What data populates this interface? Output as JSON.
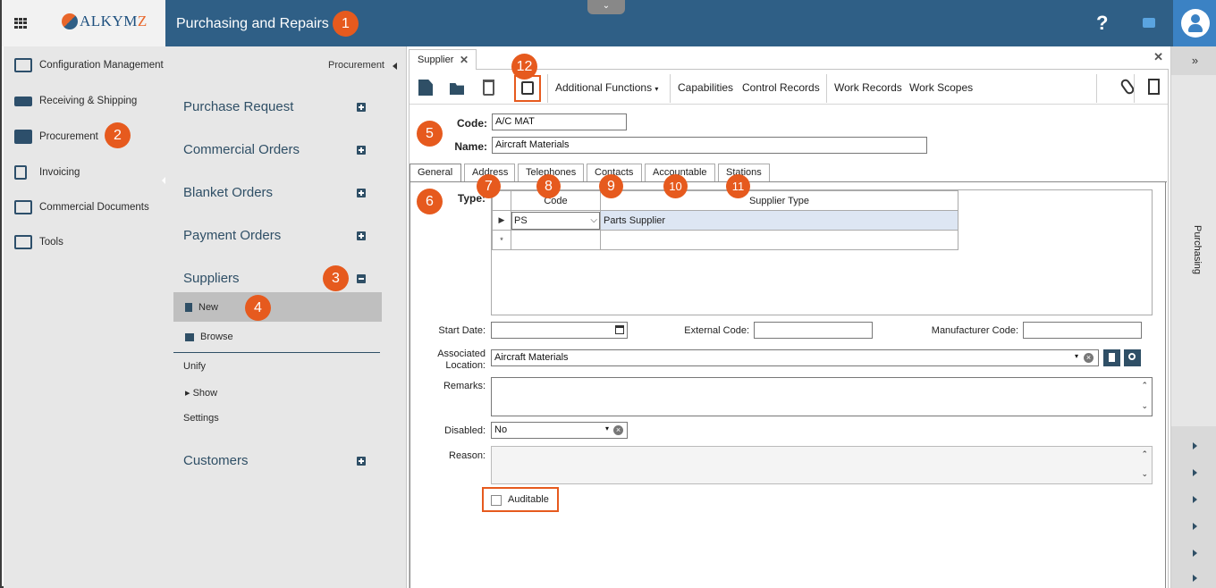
{
  "header": {
    "brand": "ALKYMZ",
    "brand_prefix": "ALKYM",
    "brand_suffix": "Z",
    "title": "Purchasing and Repairs",
    "help_glyph": "?"
  },
  "sidebar": {
    "items": [
      {
        "label": "Configuration Management",
        "icon": "edit-icon"
      },
      {
        "label": "Receiving & Shipping",
        "icon": "truck-icon"
      },
      {
        "label": "Procurement",
        "icon": "briefcase-icon"
      },
      {
        "label": "Invoicing",
        "icon": "invoice-icon"
      },
      {
        "label": "Commercial Documents",
        "icon": "documents-icon"
      },
      {
        "label": "Tools",
        "icon": "tools-icon"
      }
    ]
  },
  "nav": {
    "crumb": "Procurement",
    "groups": [
      "Purchase Request",
      "Commercial Orders",
      "Blanket Orders",
      "Payment Orders",
      "Suppliers",
      "Customers"
    ],
    "supplier_sub": {
      "new": "New",
      "browse": "Browse",
      "unify": "Unify",
      "show": "Show",
      "settings": "Settings"
    }
  },
  "document": {
    "tab_label": "Supplier",
    "close_glyph": "✕"
  },
  "toolbar": {
    "additional_functions": "Additional Functions",
    "capabilities": "Capabilities",
    "control_records": "Control Records",
    "work_records": "Work Records",
    "work_scopes": "Work Scopes"
  },
  "form": {
    "code_label": "Code:",
    "code_value": "A/C MAT",
    "name_label": "Name:",
    "name_value": "Aircraft Materials",
    "tabs": [
      "General",
      "Address",
      "Telephones",
      "Contacts",
      "Accountable",
      "Stations"
    ],
    "type_label": "Type:",
    "grid": {
      "col_code": "Code",
      "col_supplier_type": "Supplier Type",
      "rows": [
        {
          "code": "PS",
          "supplier_type": "Parts Supplier"
        }
      ],
      "new_row_marker": "*"
    },
    "start_date_label": "Start Date:",
    "external_code_label": "External Code:",
    "manufacturer_code_label": "Manufacturer Code:",
    "associated_location_label_1": "Associated",
    "associated_location_label_2": "Location:",
    "associated_location_value": "Aircraft Materials",
    "remarks_label": "Remarks:",
    "disabled_label": "Disabled:",
    "disabled_value": "No",
    "reason_label": "Reason:",
    "auditable_label": "Auditable"
  },
  "rail": {
    "expand_glyph": "»",
    "label": "Purchasing"
  },
  "callouts": [
    "1",
    "2",
    "3",
    "4",
    "5",
    "6",
    "7",
    "8",
    "9",
    "10",
    "11",
    "12"
  ],
  "colors": {
    "header": "#2f5f86",
    "callout": "#e65a1e",
    "nav_text": "#2f4f66"
  }
}
